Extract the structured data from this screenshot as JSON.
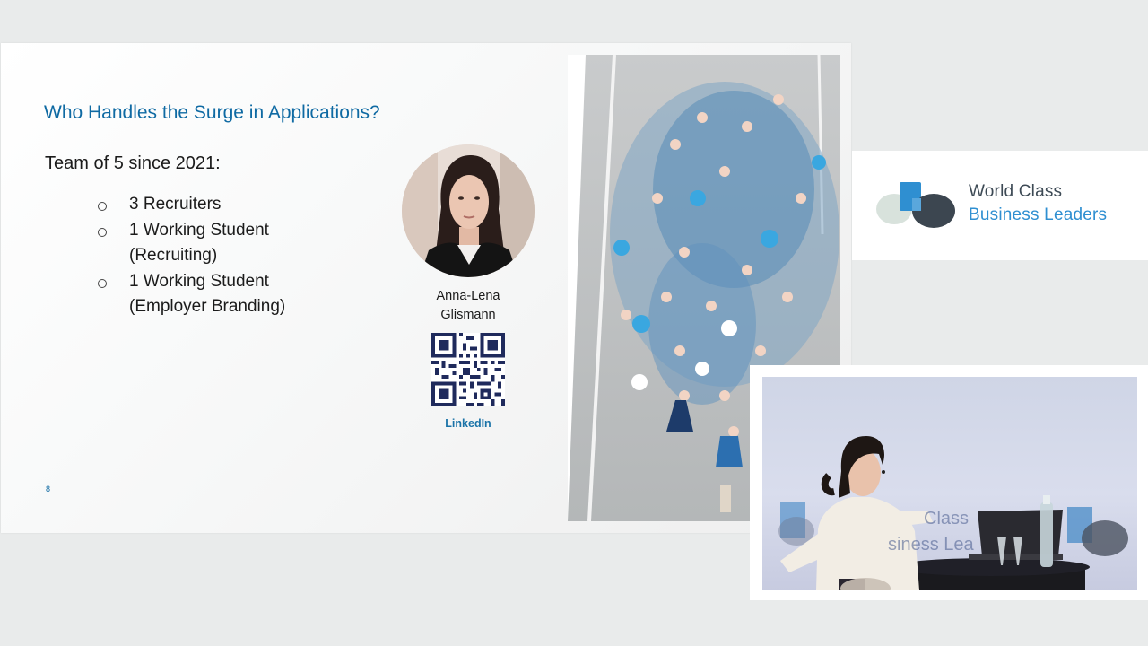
{
  "slide": {
    "title": "Who Handles the Surge in Applications?",
    "team_heading": "Team of 5 since 2021:",
    "bullets": [
      {
        "line1": "3 Recruiters",
        "line2": ""
      },
      {
        "line1": "1 Working Student",
        "line2": "(Recruiting)"
      },
      {
        "line1": "1 Working Student",
        "line2": "(Employer Branding)"
      }
    ],
    "person": {
      "first_name": "Anna-Lena",
      "last_name": "Glismann"
    },
    "qr_label": "LinkedIn",
    "page_number": "8"
  },
  "logo": {
    "line1": "World Class",
    "line2": "Business Leaders",
    "colors": {
      "blue": "#2f8fd1",
      "dark": "#3d4a55",
      "light": "#cfd8df"
    }
  },
  "camera": {
    "backdrop_line1": "Class",
    "backdrop_line2": "siness Lea"
  },
  "colors": {
    "title": "#0f6aa3",
    "background": "#e9ebeb"
  }
}
